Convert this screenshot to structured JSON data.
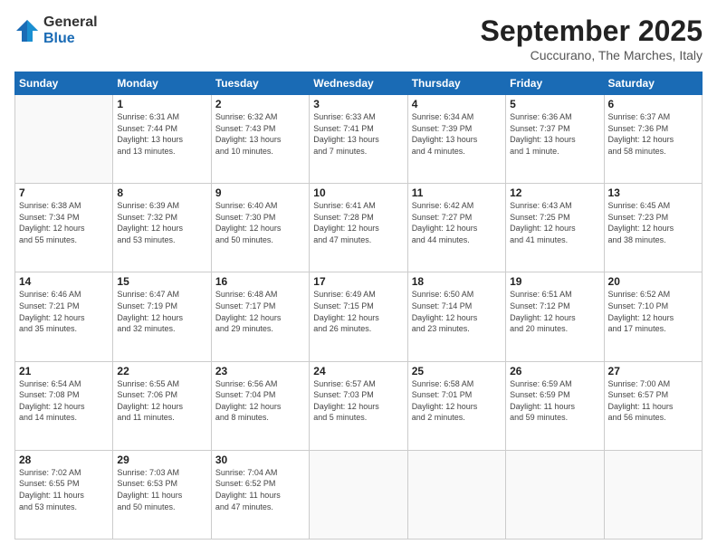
{
  "logo": {
    "general": "General",
    "blue": "Blue"
  },
  "header": {
    "month": "September 2025",
    "location": "Cuccurano, The Marches, Italy"
  },
  "weekdays": [
    "Sunday",
    "Monday",
    "Tuesday",
    "Wednesday",
    "Thursday",
    "Friday",
    "Saturday"
  ],
  "weeks": [
    [
      {
        "day": "",
        "info": ""
      },
      {
        "day": "1",
        "info": "Sunrise: 6:31 AM\nSunset: 7:44 PM\nDaylight: 13 hours\nand 13 minutes."
      },
      {
        "day": "2",
        "info": "Sunrise: 6:32 AM\nSunset: 7:43 PM\nDaylight: 13 hours\nand 10 minutes."
      },
      {
        "day": "3",
        "info": "Sunrise: 6:33 AM\nSunset: 7:41 PM\nDaylight: 13 hours\nand 7 minutes."
      },
      {
        "day": "4",
        "info": "Sunrise: 6:34 AM\nSunset: 7:39 PM\nDaylight: 13 hours\nand 4 minutes."
      },
      {
        "day": "5",
        "info": "Sunrise: 6:36 AM\nSunset: 7:37 PM\nDaylight: 13 hours\nand 1 minute."
      },
      {
        "day": "6",
        "info": "Sunrise: 6:37 AM\nSunset: 7:36 PM\nDaylight: 12 hours\nand 58 minutes."
      }
    ],
    [
      {
        "day": "7",
        "info": "Sunrise: 6:38 AM\nSunset: 7:34 PM\nDaylight: 12 hours\nand 55 minutes."
      },
      {
        "day": "8",
        "info": "Sunrise: 6:39 AM\nSunset: 7:32 PM\nDaylight: 12 hours\nand 53 minutes."
      },
      {
        "day": "9",
        "info": "Sunrise: 6:40 AM\nSunset: 7:30 PM\nDaylight: 12 hours\nand 50 minutes."
      },
      {
        "day": "10",
        "info": "Sunrise: 6:41 AM\nSunset: 7:28 PM\nDaylight: 12 hours\nand 47 minutes."
      },
      {
        "day": "11",
        "info": "Sunrise: 6:42 AM\nSunset: 7:27 PM\nDaylight: 12 hours\nand 44 minutes."
      },
      {
        "day": "12",
        "info": "Sunrise: 6:43 AM\nSunset: 7:25 PM\nDaylight: 12 hours\nand 41 minutes."
      },
      {
        "day": "13",
        "info": "Sunrise: 6:45 AM\nSunset: 7:23 PM\nDaylight: 12 hours\nand 38 minutes."
      }
    ],
    [
      {
        "day": "14",
        "info": "Sunrise: 6:46 AM\nSunset: 7:21 PM\nDaylight: 12 hours\nand 35 minutes."
      },
      {
        "day": "15",
        "info": "Sunrise: 6:47 AM\nSunset: 7:19 PM\nDaylight: 12 hours\nand 32 minutes."
      },
      {
        "day": "16",
        "info": "Sunrise: 6:48 AM\nSunset: 7:17 PM\nDaylight: 12 hours\nand 29 minutes."
      },
      {
        "day": "17",
        "info": "Sunrise: 6:49 AM\nSunset: 7:15 PM\nDaylight: 12 hours\nand 26 minutes."
      },
      {
        "day": "18",
        "info": "Sunrise: 6:50 AM\nSunset: 7:14 PM\nDaylight: 12 hours\nand 23 minutes."
      },
      {
        "day": "19",
        "info": "Sunrise: 6:51 AM\nSunset: 7:12 PM\nDaylight: 12 hours\nand 20 minutes."
      },
      {
        "day": "20",
        "info": "Sunrise: 6:52 AM\nSunset: 7:10 PM\nDaylight: 12 hours\nand 17 minutes."
      }
    ],
    [
      {
        "day": "21",
        "info": "Sunrise: 6:54 AM\nSunset: 7:08 PM\nDaylight: 12 hours\nand 14 minutes."
      },
      {
        "day": "22",
        "info": "Sunrise: 6:55 AM\nSunset: 7:06 PM\nDaylight: 12 hours\nand 11 minutes."
      },
      {
        "day": "23",
        "info": "Sunrise: 6:56 AM\nSunset: 7:04 PM\nDaylight: 12 hours\nand 8 minutes."
      },
      {
        "day": "24",
        "info": "Sunrise: 6:57 AM\nSunset: 7:03 PM\nDaylight: 12 hours\nand 5 minutes."
      },
      {
        "day": "25",
        "info": "Sunrise: 6:58 AM\nSunset: 7:01 PM\nDaylight: 12 hours\nand 2 minutes."
      },
      {
        "day": "26",
        "info": "Sunrise: 6:59 AM\nSunset: 6:59 PM\nDaylight: 11 hours\nand 59 minutes."
      },
      {
        "day": "27",
        "info": "Sunrise: 7:00 AM\nSunset: 6:57 PM\nDaylight: 11 hours\nand 56 minutes."
      }
    ],
    [
      {
        "day": "28",
        "info": "Sunrise: 7:02 AM\nSunset: 6:55 PM\nDaylight: 11 hours\nand 53 minutes."
      },
      {
        "day": "29",
        "info": "Sunrise: 7:03 AM\nSunset: 6:53 PM\nDaylight: 11 hours\nand 50 minutes."
      },
      {
        "day": "30",
        "info": "Sunrise: 7:04 AM\nSunset: 6:52 PM\nDaylight: 11 hours\nand 47 minutes."
      },
      {
        "day": "",
        "info": ""
      },
      {
        "day": "",
        "info": ""
      },
      {
        "day": "",
        "info": ""
      },
      {
        "day": "",
        "info": ""
      }
    ]
  ]
}
